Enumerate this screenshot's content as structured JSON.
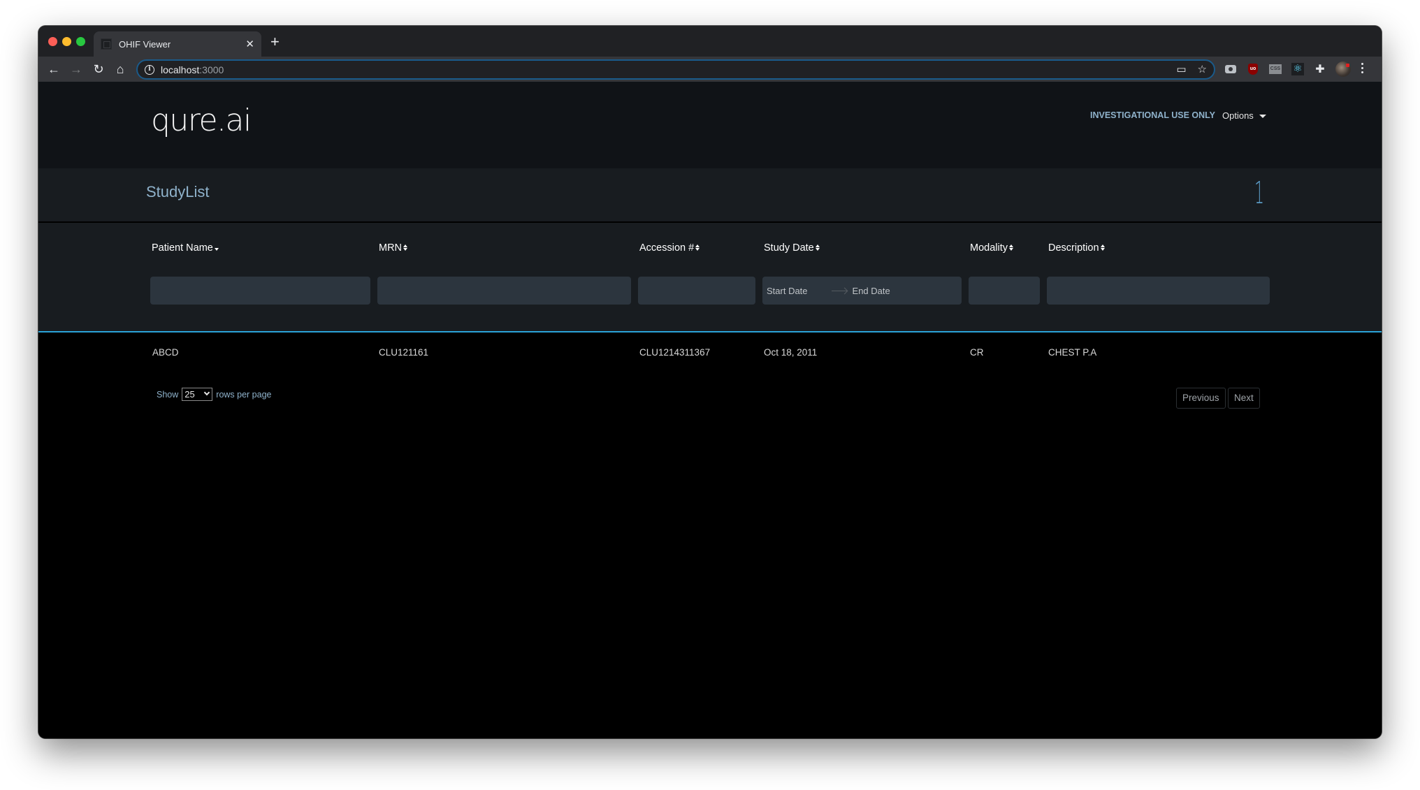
{
  "browser": {
    "tab_title": "OHIF Viewer",
    "url_host": "localhost",
    "url_port": ":3000",
    "icons": {
      "back": "arrow-left-icon",
      "forward": "arrow-right-icon",
      "reload": "reload-icon",
      "home": "home-icon",
      "info": "info-icon",
      "cast": "cast-icon",
      "bookmark": "star-icon",
      "extensions": [
        "camera-icon",
        "ublock-icon",
        "css-icon",
        "react-icon",
        "puzzle-icon"
      ],
      "menu": "kebab-menu-icon"
    }
  },
  "header": {
    "logo_text": "qure.ai",
    "investigational_label": "INVESTIGATIONAL USE ONLY",
    "options_label": "Options"
  },
  "studylist": {
    "title": "StudyList",
    "count": "1"
  },
  "columns": [
    {
      "label": "Patient Name",
      "sort": "desc"
    },
    {
      "label": "MRN",
      "sort": "both"
    },
    {
      "label": "Accession #",
      "sort": "both"
    },
    {
      "label": "Study Date",
      "sort": "both"
    },
    {
      "label": "Modality",
      "sort": "both"
    },
    {
      "label": "Description",
      "sort": "both"
    }
  ],
  "filters": {
    "patient_name": "",
    "mrn": "",
    "accession": "",
    "start_date_placeholder": "Start Date",
    "end_date_placeholder": "End Date",
    "modality": "",
    "description": ""
  },
  "rows": [
    {
      "patient_name": "ABCD",
      "mrn": "CLU121161",
      "accession": "CLU1214311367",
      "study_date": "Oct 18, 2011",
      "modality": "CR",
      "description": "CHEST P.A"
    }
  ],
  "pagination": {
    "show_label": "Show",
    "rows_per_page_value": "25",
    "rows_per_page_label": "rows per page",
    "previous_label": "Previous",
    "next_label": "Next"
  },
  "colors": {
    "accent": "#2ba3d9",
    "label_blue": "#8fb2cb",
    "header_bg": "#101317",
    "panel_bg": "#181c20",
    "input_bg": "#2c353e"
  }
}
